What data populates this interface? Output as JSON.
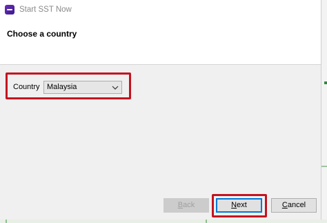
{
  "window": {
    "title": "Start SST Now",
    "icon": "app-icon"
  },
  "header": {
    "title": "Choose a country"
  },
  "form": {
    "country_label": "Country",
    "country_value": "Malaysia",
    "dropdown_icon": "chevron-down-icon"
  },
  "buttons": {
    "back_first": "B",
    "back_rest": "ack",
    "next_first": "N",
    "next_rest": "ext",
    "cancel_first": "C",
    "cancel_rest": "ancel"
  },
  "colors": {
    "highlight": "#c4121f",
    "focus": "#0078d7",
    "app_icon": "#5a27a8"
  }
}
